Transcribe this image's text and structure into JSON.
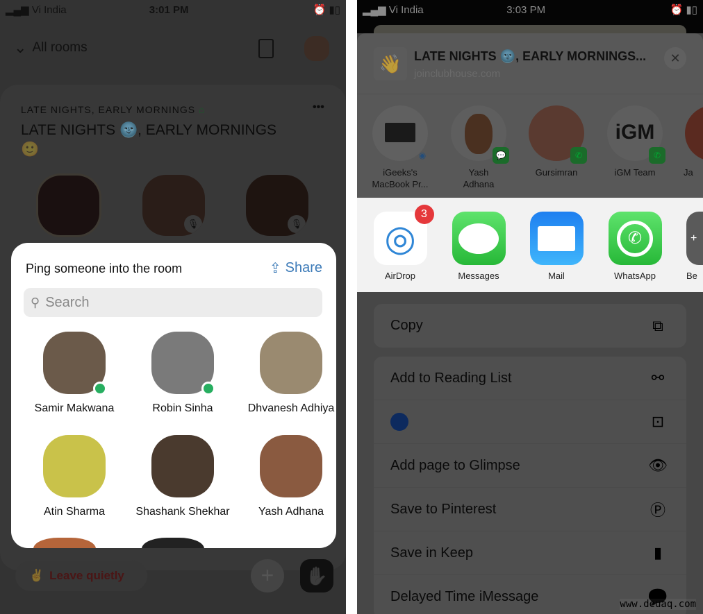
{
  "left": {
    "status": {
      "carrier": "Vi India",
      "time": "3:01 PM"
    },
    "header": {
      "back_label": "All rooms"
    },
    "room": {
      "club": "LATE NIGHTS, EARLY MORNINGS",
      "title": "LATE NIGHTS 🌚, EARLY MORNINGS",
      "title_emoji": "🙂",
      "more": "•••"
    },
    "ping": {
      "title": "Ping someone into the room",
      "share_label": "Share",
      "search_placeholder": "Search",
      "people": [
        {
          "name": "Samir Makwana",
          "online": true,
          "color": "#6b5a4a"
        },
        {
          "name": "Robin Sinha",
          "online": true,
          "color": "#7a7a7a"
        },
        {
          "name": "Dhvanesh Adhiya",
          "online": false,
          "color": "#9a8a70"
        },
        {
          "name": "Atin Sharma",
          "online": false,
          "color": "#c9c24a"
        },
        {
          "name": "Shashank Shekhar",
          "online": false,
          "color": "#4a3a2e"
        },
        {
          "name": "Yash Adhana",
          "online": false,
          "color": "#8a5a40"
        }
      ]
    },
    "footer": {
      "leave_label": "Leave quietly",
      "leave_emoji": "✌️",
      "add": "+",
      "hand": "✋"
    }
  },
  "right": {
    "status": {
      "carrier": "Vi India",
      "time": "3:03 PM"
    },
    "share_header": {
      "title": "LATE NIGHTS 🌚, EARLY MORNINGS...",
      "subtitle": "joinclubhouse.com",
      "thumb_emoji": "👋",
      "close": "✕"
    },
    "contacts": [
      {
        "line1": "iGeeks's",
        "line2": "MacBook Pr..."
      },
      {
        "line1": "Yash",
        "line2": "Adhana"
      },
      {
        "line1": "Gursimran",
        "line2": ""
      },
      {
        "line1": "iGM Team",
        "line2": ""
      },
      {
        "line1": "Ja",
        "line2": ""
      }
    ],
    "contact_logo": "iGM",
    "apps": [
      {
        "label": "AirDrop",
        "badge": "3"
      },
      {
        "label": "Messages"
      },
      {
        "label": "Mail"
      },
      {
        "label": "WhatsApp"
      },
      {
        "label": "Be"
      }
    ],
    "actions_group1": [
      {
        "label": "Copy",
        "icon": "copy-icon"
      }
    ],
    "actions_group2": [
      {
        "label": "Add to Reading List",
        "icon": "glasses-icon"
      },
      {
        "label": "",
        "icon": "square-dot-icon"
      },
      {
        "label": "Add page to Glimpse",
        "icon": "eye-icon"
      },
      {
        "label": "Save to Pinterest",
        "icon": "pinterest-icon"
      },
      {
        "label": "Save in Keep",
        "icon": "bookmark-icon"
      },
      {
        "label": "Delayed Time iMessage",
        "icon": "chat-bubbles-icon"
      }
    ],
    "watermark": "www.deuaq.com"
  },
  "colors": {
    "online": "#27ae60",
    "share_blue": "#3d7bb8",
    "badge_red": "#e5383b",
    "leave_red": "#4a1515"
  }
}
